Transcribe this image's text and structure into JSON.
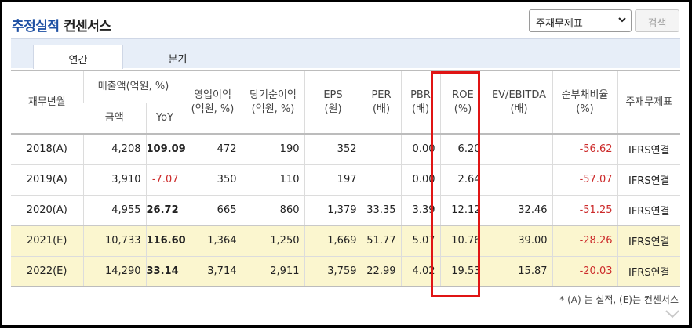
{
  "header": {
    "title_blue": "추정실적",
    "title_dark": "컨센서스"
  },
  "filter": {
    "select_value": "주재무제표",
    "search_label": "검색"
  },
  "tabs": [
    {
      "label": "연간",
      "active": true
    },
    {
      "label": "분기",
      "active": false
    }
  ],
  "table": {
    "headers": {
      "fiscal": "재무년월",
      "sales": "매출액(억원, %)",
      "sales_amount": "금액",
      "sales_yoy": "YoY",
      "op": "영업이익",
      "op_unit": "(억원, %)",
      "net": "당기순이익",
      "net_unit": "(억원, %)",
      "eps": "EPS",
      "eps_unit": "(원)",
      "per": "PER",
      "per_unit": "(배)",
      "pbr": "PBR",
      "pbr_unit": "(배)",
      "roe": "ROE",
      "roe_unit": "(%)",
      "ev": "EV/EBITDA",
      "ev_unit": "(배)",
      "debt": "순부채비율",
      "debt_unit": "(%)",
      "stmt": "주재무제표"
    },
    "rows": [
      {
        "period": "2018(A)",
        "sales": "4,208",
        "yoy": "109.09",
        "op": "472",
        "net": "190",
        "eps": "352",
        "per": "",
        "pbr": "0.00",
        "roe": "6.20",
        "ev": "",
        "debt": "-56.62",
        "stmt": "IFRS연결"
      },
      {
        "period": "2019(A)",
        "sales": "3,910",
        "yoy": "-7.07",
        "op": "350",
        "net": "110",
        "eps": "197",
        "per": "",
        "pbr": "0.00",
        "roe": "2.64",
        "ev": "",
        "debt": "-57.07",
        "stmt": "IFRS연결"
      },
      {
        "period": "2020(A)",
        "sales": "4,955",
        "yoy": "26.72",
        "op": "665",
        "net": "860",
        "eps": "1,379",
        "per": "33.35",
        "pbr": "3.39",
        "roe": "12.12",
        "ev": "32.46",
        "debt": "-51.25",
        "stmt": "IFRS연결"
      },
      {
        "period": "2021(E)",
        "sales": "10,733",
        "yoy": "116.60",
        "op": "1,364",
        "net": "1,250",
        "eps": "1,669",
        "per": "51.77",
        "pbr": "5.07",
        "roe": "10.76",
        "ev": "39.00",
        "debt": "-28.26",
        "stmt": "IFRS연결"
      },
      {
        "period": "2022(E)",
        "sales": "14,290",
        "yoy": "33.14",
        "op": "3,714",
        "net": "2,911",
        "eps": "3,759",
        "per": "22.99",
        "pbr": "4.02",
        "roe": "19.53",
        "ev": "15.87",
        "debt": "-20.03",
        "stmt": "IFRS연결"
      }
    ]
  },
  "footnote": "* (A) 는 실적, (E)는 컨센서스",
  "colors": {
    "title_blue": "#1d4fa3",
    "negative_red": "#cc2a2a",
    "estimate_row_bg": "#fbf6cf",
    "highlight_box": "#e01414"
  }
}
